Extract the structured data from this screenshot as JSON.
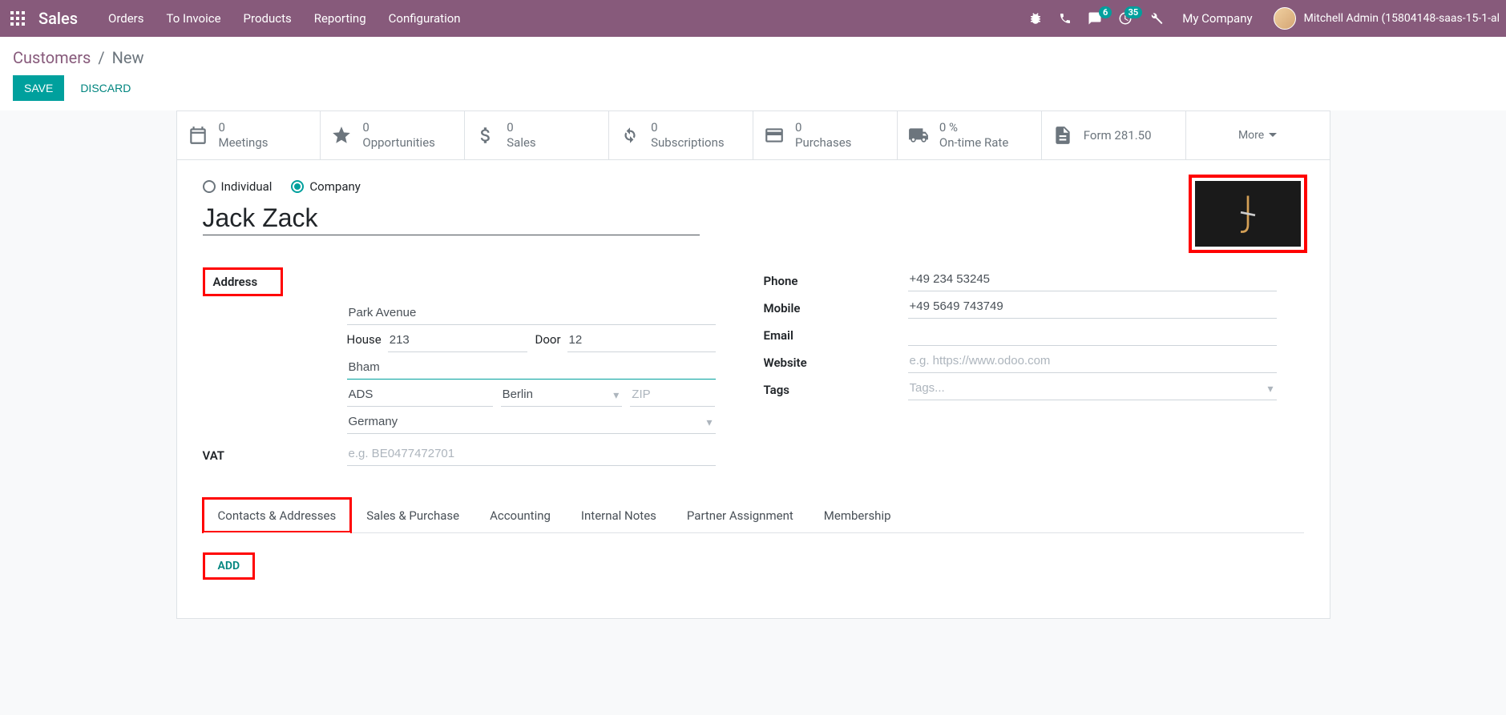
{
  "navbar": {
    "brand": "Sales",
    "menu": [
      "Orders",
      "To Invoice",
      "Products",
      "Reporting",
      "Configuration"
    ],
    "msg_badge": "6",
    "activity_badge": "35",
    "company": "My Company",
    "user": "Mitchell Admin (15804148-saas-15-1-al"
  },
  "breadcrumb": {
    "parent": "Customers",
    "current": "New"
  },
  "buttons": {
    "save": "SAVE",
    "discard": "DISCARD"
  },
  "stats": {
    "meetings": {
      "val": "0",
      "label": "Meetings"
    },
    "opportunities": {
      "val": "0",
      "label": "Opportunities"
    },
    "sales": {
      "val": "0",
      "label": "Sales"
    },
    "subscriptions": {
      "val": "0",
      "label": "Subscriptions"
    },
    "purchases": {
      "val": "0",
      "label": "Purchases"
    },
    "ontime": {
      "val": "0 %",
      "label": "On-time Rate"
    },
    "form": "Form 281.50",
    "more": "More"
  },
  "type": {
    "individual": "Individual",
    "company": "Company"
  },
  "name": "Jack Zack",
  "labels": {
    "address": "Address",
    "house": "House",
    "door": "Door",
    "vat": "VAT",
    "phone": "Phone",
    "mobile": "Mobile",
    "email": "Email",
    "website": "Website",
    "tags": "Tags"
  },
  "address": {
    "street": "Park Avenue",
    "house": "213",
    "door": "12",
    "street2": "Bham",
    "city": "ADS",
    "state": "Berlin",
    "zip_placeholder": "ZIP",
    "country": "Germany"
  },
  "vat_placeholder": "e.g. BE0477472701",
  "contact": {
    "phone": "+49 234 53245",
    "mobile": "+49 5649 743749",
    "email": "",
    "website_placeholder": "e.g. https://www.odoo.com",
    "tags_placeholder": "Tags..."
  },
  "tabs": [
    "Contacts & Addresses",
    "Sales & Purchase",
    "Accounting",
    "Internal Notes",
    "Partner Assignment",
    "Membership"
  ],
  "add_label": "ADD"
}
